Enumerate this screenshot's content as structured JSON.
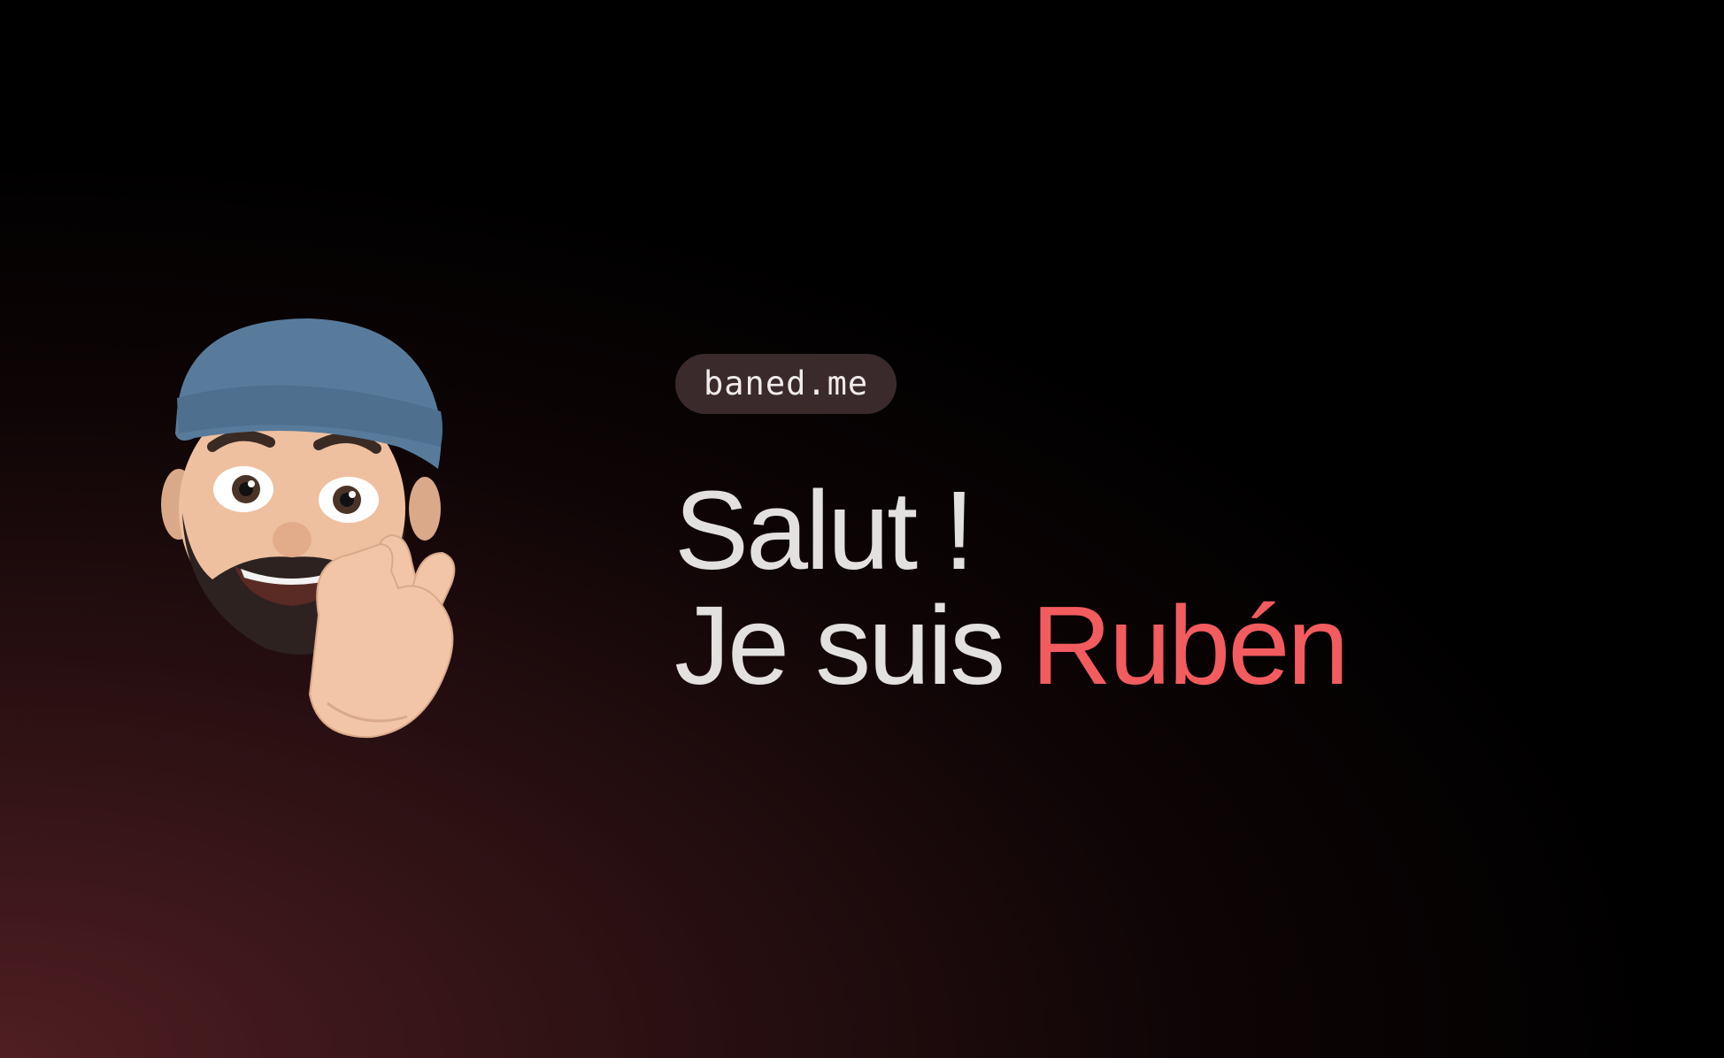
{
  "domain_badge": "baned.me",
  "headline": {
    "line1": "Salut !",
    "line2_prefix": "Je suis",
    "line2_name": "Rubén"
  },
  "colors": {
    "background_dark": "#000000",
    "background_glow": "#4f1e22",
    "accent": "#f25c5f",
    "text": "#e3e0e0",
    "pill_bg": "#3a2a2c"
  },
  "avatar": {
    "icon": "memoji-peace-sign-icon"
  }
}
